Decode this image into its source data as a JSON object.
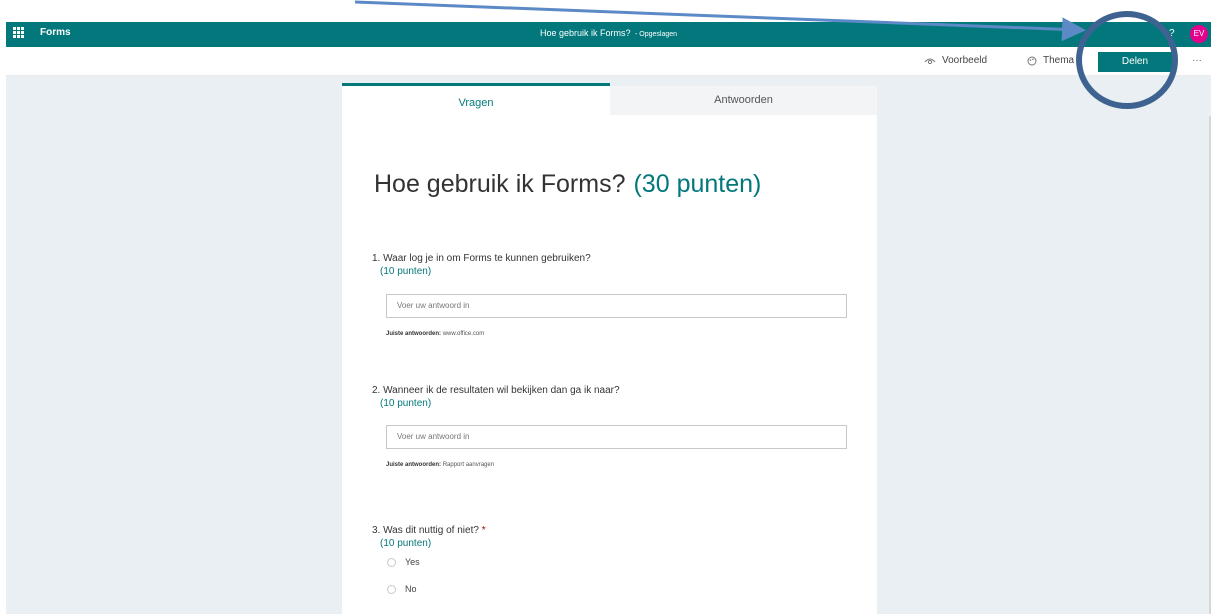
{
  "app_bar": {
    "app_name": "Forms",
    "doc_title": "Hoe gebruik ik Forms?",
    "save_status": "- Opgeslagen",
    "help": "?",
    "avatar_initials": "EV"
  },
  "command_bar": {
    "preview_label": "Voorbeeld",
    "theme_label": "Thema",
    "share_label": "Delen",
    "more_label": "···"
  },
  "tabs": {
    "questions": "Vragen",
    "responses": "Antwoorden",
    "active": "questions"
  },
  "form": {
    "title": "Hoe gebruik ik Forms?",
    "total_points": "(30 punten)",
    "questions": [
      {
        "text": "1. Waar log je in om Forms te kunnen gebruiken?",
        "points": "(10 punten)",
        "placeholder": "Voer uw antwoord in",
        "correct_label": "Juiste antwoorden:",
        "correct_value": "www.office.com"
      },
      {
        "text": "2. Wanneer ik de resultaten wil bekijken dan ga ik naar?",
        "points": "(10 punten)",
        "placeholder": "Voer uw antwoord in",
        "correct_label": "Juiste antwoorden:",
        "correct_value": "Rapport aanvragen"
      },
      {
        "text": "3. Was dit nuttig of niet?",
        "required_mark": "*",
        "points": "(10 punten)",
        "options": [
          "Yes",
          "No"
        ]
      }
    ]
  },
  "colors": {
    "accent": "#03787c",
    "avatar": "#e3008c",
    "annotation": "#3f6391"
  }
}
